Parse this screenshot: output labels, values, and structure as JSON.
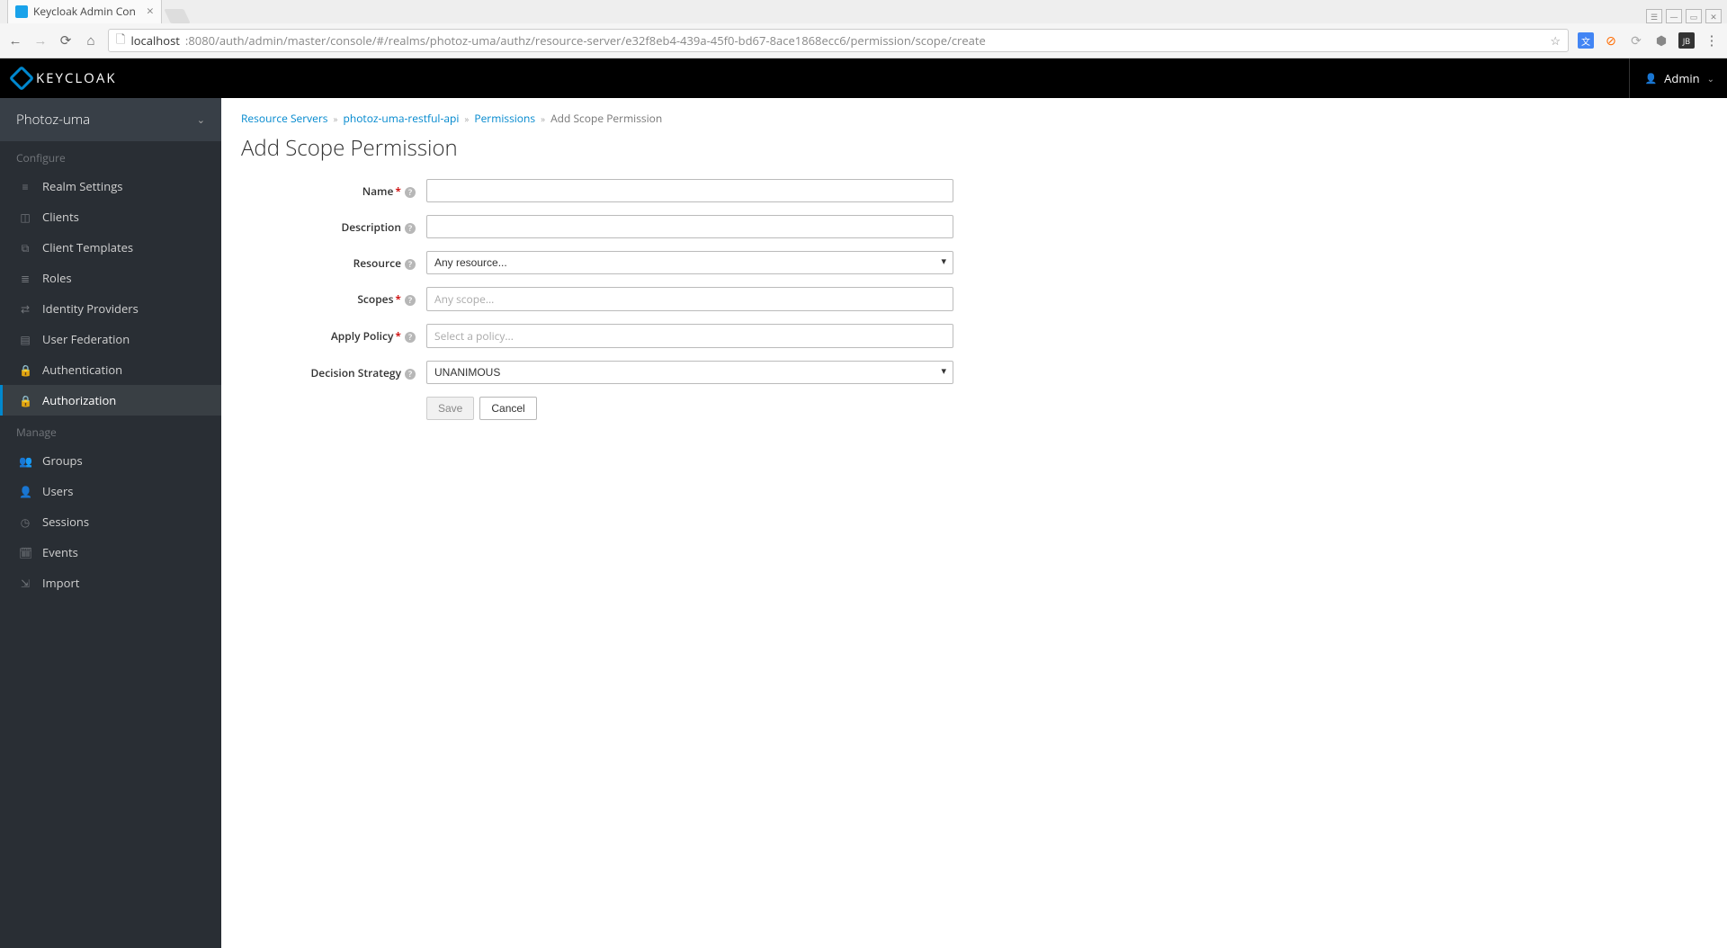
{
  "browser": {
    "tab_title": "Keycloak Admin Con",
    "url_host": "localhost",
    "url_path": ":8080/auth/admin/master/console/#/realms/photoz-uma/authz/resource-server/e32f8eb4-439a-45f0-bd67-8ace1868ecc6/permission/scope/create"
  },
  "header": {
    "brand": "KEYCLOAK",
    "user_label": "Admin"
  },
  "sidebar": {
    "realm": "Photoz-uma",
    "section_configure": "Configure",
    "section_manage": "Manage",
    "configure_items": [
      {
        "label": "Realm Settings",
        "icon": "sliders-icon"
      },
      {
        "label": "Clients",
        "icon": "cube-icon"
      },
      {
        "label": "Client Templates",
        "icon": "cubes-icon"
      },
      {
        "label": "Roles",
        "icon": "list-icon"
      },
      {
        "label": "Identity Providers",
        "icon": "exchange-icon"
      },
      {
        "label": "User Federation",
        "icon": "database-icon"
      },
      {
        "label": "Authentication",
        "icon": "lock-icon"
      },
      {
        "label": "Authorization",
        "icon": "lock-icon",
        "active": true
      }
    ],
    "manage_items": [
      {
        "label": "Groups",
        "icon": "group-icon"
      },
      {
        "label": "Users",
        "icon": "user-icon"
      },
      {
        "label": "Sessions",
        "icon": "clock-icon"
      },
      {
        "label": "Events",
        "icon": "calendar-icon"
      },
      {
        "label": "Import",
        "icon": "import-icon"
      }
    ]
  },
  "breadcrumb": {
    "items": [
      {
        "label": "Resource Servers",
        "link": true
      },
      {
        "label": "photoz-uma-restful-api",
        "link": true
      },
      {
        "label": "Permissions",
        "link": true
      },
      {
        "label": "Add Scope Permission",
        "link": false
      }
    ]
  },
  "page": {
    "title": "Add Scope Permission",
    "fields": {
      "name_label": "Name",
      "description_label": "Description",
      "resource_label": "Resource",
      "resource_placeholder": "Any resource...",
      "scopes_label": "Scopes",
      "scopes_placeholder": "Any scope...",
      "apply_policy_label": "Apply Policy",
      "apply_policy_placeholder": "Select a policy...",
      "decision_label": "Decision Strategy",
      "decision_value": "UNANIMOUS"
    },
    "buttons": {
      "save": "Save",
      "cancel": "Cancel"
    }
  },
  "icons": {
    "sliders-icon": "≡",
    "cube-icon": "◫",
    "cubes-icon": "⧉",
    "list-icon": "≣",
    "exchange-icon": "⇄",
    "database-icon": "▤",
    "lock-icon": "🔒",
    "group-icon": "👥",
    "user-icon": "👤",
    "clock-icon": "◷",
    "calendar-icon": "🗓",
    "import-icon": "⇲"
  }
}
